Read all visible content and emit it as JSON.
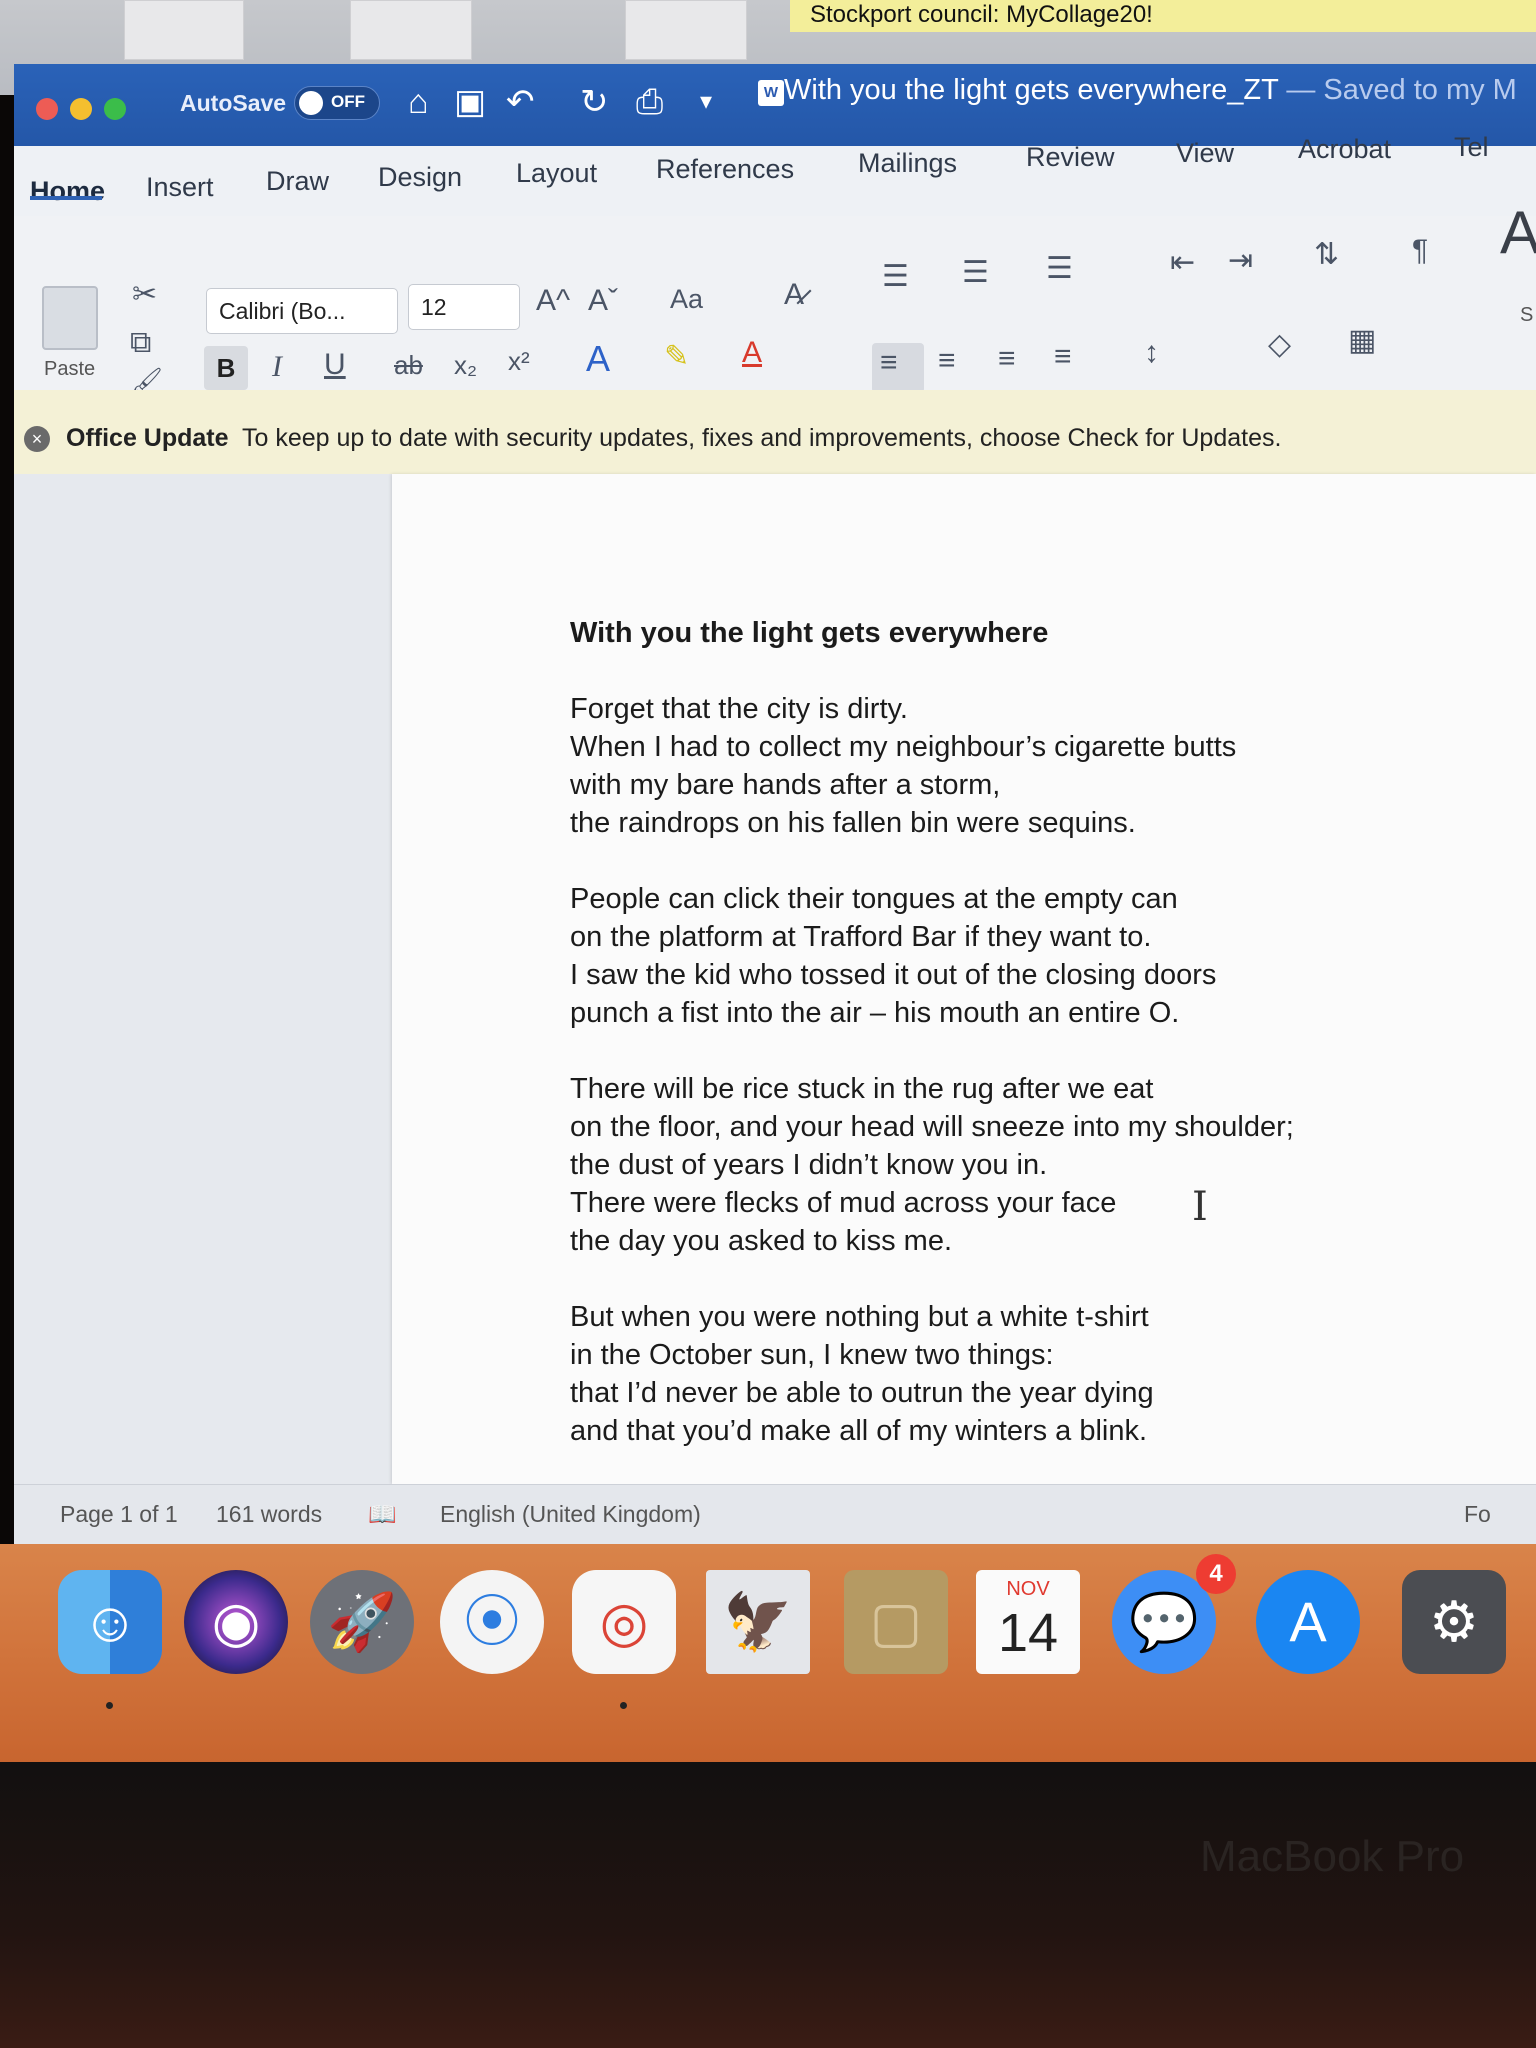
{
  "notification": {
    "text": "Stockport council: MyCollage20!"
  },
  "titlebar": {
    "autosave_label": "AutoSave",
    "autosave_state": "OFF",
    "doc_title": "With you the light gets everywhere_ZT",
    "saved_status": "— Saved to my M"
  },
  "tabs": [
    "Home",
    "Insert",
    "Draw",
    "Design",
    "Layout",
    "References",
    "Mailings",
    "Review",
    "View",
    "Acrobat",
    "Tel"
  ],
  "ribbon": {
    "paste_label": "Paste",
    "font_name": "Calibri (Bo...",
    "font_size": "12",
    "change_case": "Aa",
    "bold": "B",
    "italic": "I",
    "underline": "U",
    "strikethrough": "ab",
    "subscript": "x₂",
    "superscript": "x²",
    "grow_font": "A^",
    "shrink_font": "Aˇ",
    "font_color": "A",
    "styles_partial": "S"
  },
  "update_bar": {
    "title": "Office Update",
    "message": "To keep up to date with security updates, fixes and improvements, choose Check for Updates."
  },
  "document": {
    "title": "With you the light gets everywhere",
    "stanzas": [
      [
        "Forget that the city is dirty.",
        "When I had to collect my neighbour’s cigarette butts",
        "with my bare hands after a storm,",
        "the raindrops on his fallen bin were sequins."
      ],
      [
        "People can click their tongues at the empty can",
        "on the platform at Trafford Bar if they want to.",
        "I saw the kid who tossed it out of the closing doors",
        "punch a fist into the air – his mouth an entire O."
      ],
      [
        "There will be rice stuck in the rug after we eat",
        "on the floor, and your head will sneeze into my shoulder;",
        "the dust of years I didn’t know you in.",
        "There were flecks of mud across your face",
        "the day you asked to kiss me."
      ],
      [
        "But when you were nothing but a white t-shirt",
        "in the October sun, I knew two things:",
        "that I’d never be able to outrun the year dying",
        "and that you’d make all of my winters a blink."
      ]
    ]
  },
  "statusbar": {
    "page": "Page 1 of 1",
    "words": "161 words",
    "language": "English (United Kingdom)",
    "focus_partial": "Fo"
  },
  "dock": {
    "calendar_month": "NOV",
    "calendar_day": "14",
    "messages_badge": "4"
  },
  "bezel_label": "MacBook Pro"
}
